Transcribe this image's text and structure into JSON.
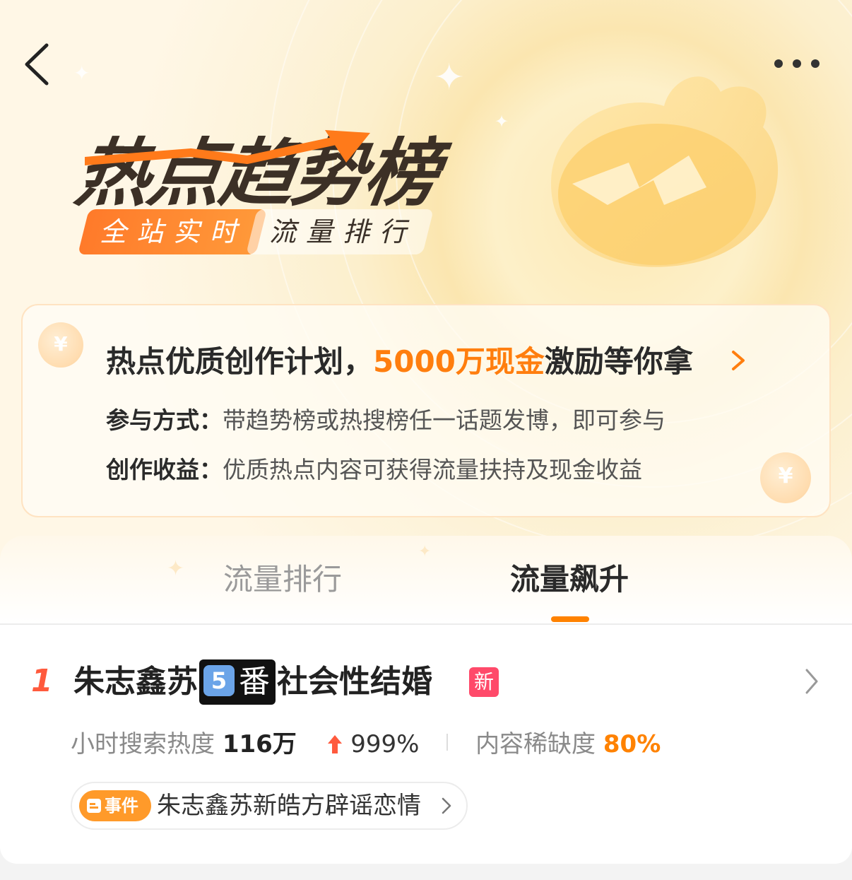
{
  "header": {
    "back_icon": "back-chevron-icon",
    "more_icon": "more-dots-icon"
  },
  "hero": {
    "title": "热点趋势榜",
    "badge_primary": "全站实时",
    "badge_secondary": "流量排行"
  },
  "promo": {
    "title_prefix": "热点优质创作计划，",
    "title_highlight": "5000万现金",
    "title_suffix": "激励等你拿",
    "rows": [
      {
        "key": "参与方式：",
        "value": "带趋势榜或热搜榜任一话题发博，即可参与"
      },
      {
        "key": "创作收益：",
        "value": "优质热点内容可获得流量扶持及现金收益"
      }
    ],
    "coin_symbol": "¥",
    "accent_color": "#ff7e0e"
  },
  "tabs": [
    {
      "label": "流量排行",
      "active": false
    },
    {
      "label": "流量飙升",
      "active": true
    }
  ],
  "list": [
    {
      "rank": "1",
      "title_part1": "朱志鑫苏",
      "emoji_number": "5",
      "emoji_char": "番",
      "title_part2": "社会性结婚",
      "badge": "新",
      "stats": {
        "search_label": "小时搜索热度",
        "search_value": "116万",
        "growth": "999%",
        "scarcity_label": "内容稀缺度",
        "scarcity_value": "80%"
      },
      "event": {
        "tag": "事件",
        "text": "朱志鑫苏新皓方辟谣恋情"
      }
    }
  ]
}
